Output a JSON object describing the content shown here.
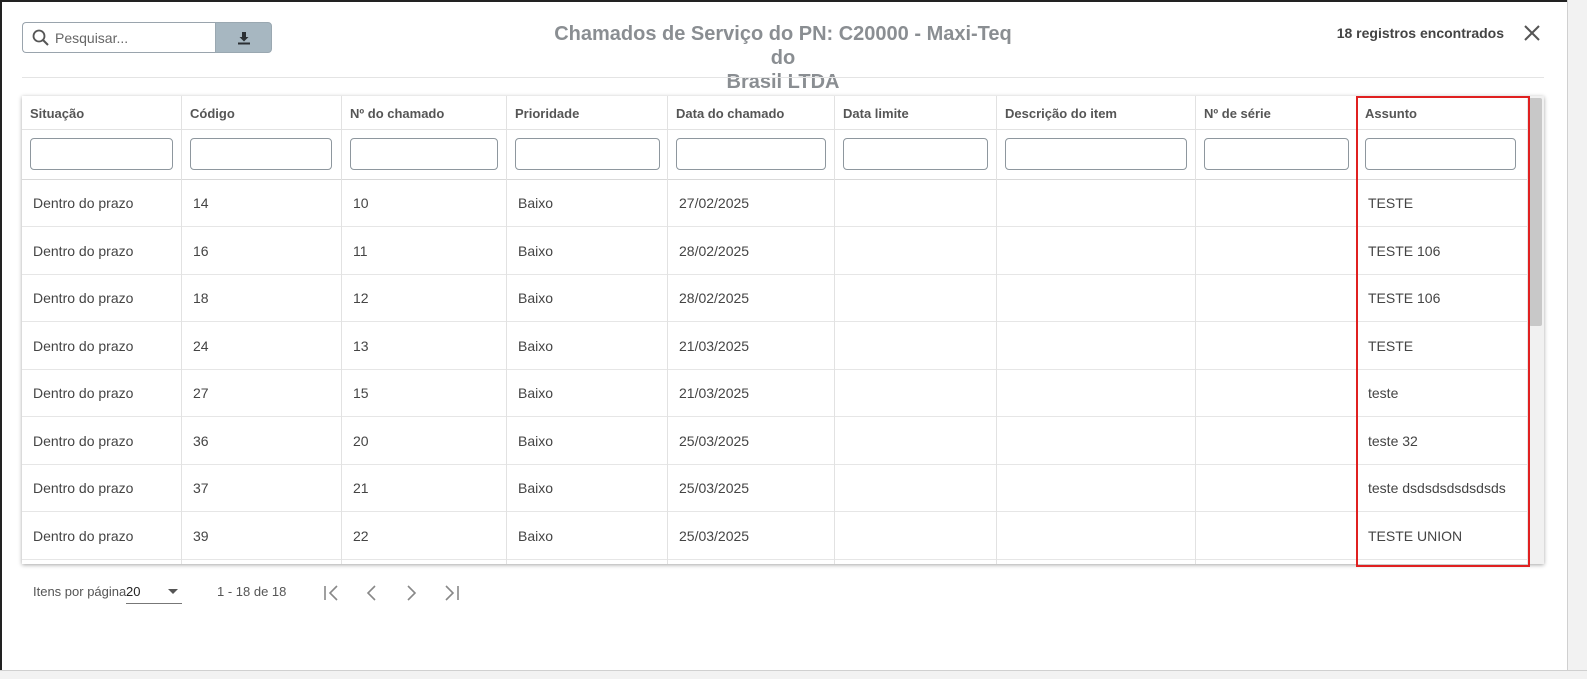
{
  "search": {
    "placeholder": "Pesquisar..."
  },
  "icons": {
    "search": "search-icon",
    "download": "download-icon",
    "close": "close-icon"
  },
  "header": {
    "title_line1": "Chamados de Serviço do PN: C20000 - Maxi-Teq do",
    "title_line2": "Brasil LTDA",
    "count": "18 registros encontrados"
  },
  "table": {
    "columns": [
      "Situação",
      "Código",
      "Nº do chamado",
      "Prioridade",
      "Data do chamado",
      "Data limite",
      "Descrição do item",
      "Nº de série",
      "Assunto"
    ],
    "rows": [
      [
        "Dentro do prazo",
        "14",
        "10",
        "Baixo",
        "27/02/2025",
        "",
        "",
        "",
        "TESTE"
      ],
      [
        "Dentro do prazo",
        "16",
        "11",
        "Baixo",
        "28/02/2025",
        "",
        "",
        "",
        "TESTE 106"
      ],
      [
        "Dentro do prazo",
        "18",
        "12",
        "Baixo",
        "28/02/2025",
        "",
        "",
        "",
        "TESTE 106"
      ],
      [
        "Dentro do prazo",
        "24",
        "13",
        "Baixo",
        "21/03/2025",
        "",
        "",
        "",
        "TESTE"
      ],
      [
        "Dentro do prazo",
        "27",
        "15",
        "Baixo",
        "21/03/2025",
        "",
        "",
        "",
        "teste"
      ],
      [
        "Dentro do prazo",
        "36",
        "20",
        "Baixo",
        "25/03/2025",
        "",
        "",
        "",
        "teste 32"
      ],
      [
        "Dentro do prazo",
        "37",
        "21",
        "Baixo",
        "25/03/2025",
        "",
        "",
        "",
        "teste dsdsdsdsdsdsds"
      ],
      [
        "Dentro do prazo",
        "39",
        "22",
        "Baixo",
        "25/03/2025",
        "",
        "",
        "",
        "TESTE UNION"
      ]
    ]
  },
  "paginator": {
    "items_label": "Itens por página",
    "page_size": "20",
    "range": "1 - 18 de 18"
  },
  "colors": {
    "highlight": "#e02020",
    "download_button": "#a7b7c1",
    "title": "#8a8e92"
  }
}
